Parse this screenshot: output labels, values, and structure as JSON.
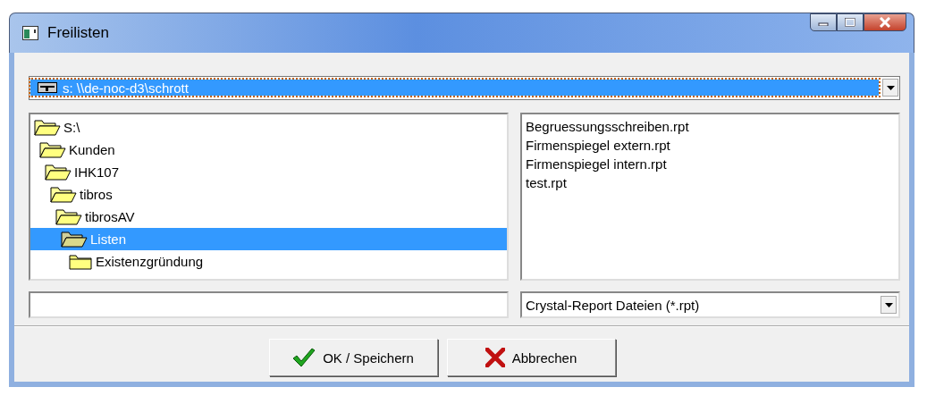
{
  "window": {
    "title": "Freilisten"
  },
  "drive": {
    "value": "s: \\\\de-noc-d3\\schrott"
  },
  "tree": [
    {
      "label": "S:\\",
      "expanded": true,
      "selected": false,
      "children": [
        {
          "label": "Kunden",
          "expanded": true,
          "selected": false,
          "children": [
            {
              "label": "IHK107",
              "expanded": true,
              "selected": false,
              "children": [
                {
                  "label": "tibros",
                  "expanded": true,
                  "selected": false,
                  "children": [
                    {
                      "label": "tibrosAV",
                      "expanded": true,
                      "selected": false,
                      "children": [
                        {
                          "label": "Listen",
                          "expanded": true,
                          "selected": true,
                          "children": [
                            {
                              "label": "Existenzgründung",
                              "expanded": false,
                              "selected": false
                            }
                          ]
                        }
                      ]
                    }
                  ]
                }
              ]
            }
          ]
        }
      ]
    }
  ],
  "files": [
    "Begruessungsschreiben.rpt",
    "Firmenspiegel extern.rpt",
    "Firmenspiegel intern.rpt",
    "test.rpt"
  ],
  "filter": {
    "value": "Crystal-Report Dateien (*.rpt)"
  },
  "buttons": [
    {
      "kind": "ok",
      "label": "OK / Speichern"
    },
    {
      "kind": "cancel",
      "label": "Abbrechen"
    }
  ]
}
